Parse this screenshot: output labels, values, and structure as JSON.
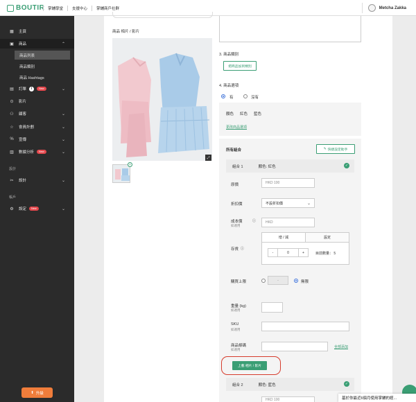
{
  "brand": {
    "name": "BOUTIR",
    "accent": "#3a9e74"
  },
  "topnav": [
    "掌舖學堂",
    "支援中心",
    "掌舖商戶社群"
  ],
  "user": {
    "name": "Metcha Zakka"
  },
  "sidebar": {
    "items": [
      {
        "label": "主頁",
        "icon": "home-icon"
      },
      {
        "label": "商品",
        "icon": "box-icon"
      },
      {
        "label": "訂單",
        "icon": "order-icon",
        "info": "i",
        "badge": "New"
      },
      {
        "label": "影片",
        "icon": "play-icon"
      },
      {
        "label": "顧客",
        "icon": "user-icon"
      },
      {
        "label": "會員計劃",
        "icon": "star-icon"
      },
      {
        "label": "宣傳",
        "icon": "megaphone-icon"
      },
      {
        "label": "數據分析",
        "icon": "chart-icon",
        "badge": "New"
      },
      {
        "label": "設計",
        "icon": "design-icon"
      },
      {
        "label": "設定",
        "icon": "gear-icon",
        "badge": "New"
      }
    ],
    "sub_items": [
      "商品列表",
      "商品類別",
      "商品 Hashtags"
    ],
    "sections": {
      "store": "設計",
      "account": "帳戶"
    },
    "upgrade_label": "升級"
  },
  "main": {
    "photos_label": "商品 相片 / 影片",
    "category": {
      "label": "3. 商品類別",
      "button": "把商品加到類別"
    },
    "options": {
      "label": "4. 商品選項",
      "yes": "有",
      "no": "沒有",
      "yes_selected": true,
      "values_row": [
        "顏色",
        "紅色",
        "藍色"
      ],
      "change_link": "更改商品選項"
    },
    "combos": {
      "title": "所有組合",
      "quick_button": "快捷設定助手",
      "combo1": {
        "name": "組合 1",
        "value": "顏色: 紅色"
      },
      "combo2": {
        "name": "組合 2",
        "value": "顏色: 藍色"
      },
      "fields": {
        "price": {
          "label": "原價",
          "placeholder": "HKD 100"
        },
        "discount": {
          "label": "折扣價",
          "value": "不設折扣價"
        },
        "cost": {
          "label": "成本價",
          "sub": "如適用",
          "placeholder": "HKD"
        },
        "stock": {
          "label": "存貨",
          "tab_add": "增 / 減",
          "tab_set": "設定",
          "minus": "-",
          "value": "0",
          "plus": "+",
          "current": "目前數量： 5"
        },
        "limit": {
          "label": "購買上限",
          "value": "-",
          "unlimited": "無限",
          "unlimited_selected": true
        },
        "weight": {
          "label": "重量 (kg)",
          "sub": "如適用"
        },
        "sku": {
          "label": "SKU",
          "sub": "如適用"
        },
        "barcode": {
          "label": "商品條碼",
          "sub": "如適用",
          "link": "全部添加"
        }
      },
      "upload_button": "上載 相片 / 影片",
      "combo2_price": "HKD 100"
    }
  },
  "notification": "基於你最近6個月使用掌舖的經..."
}
